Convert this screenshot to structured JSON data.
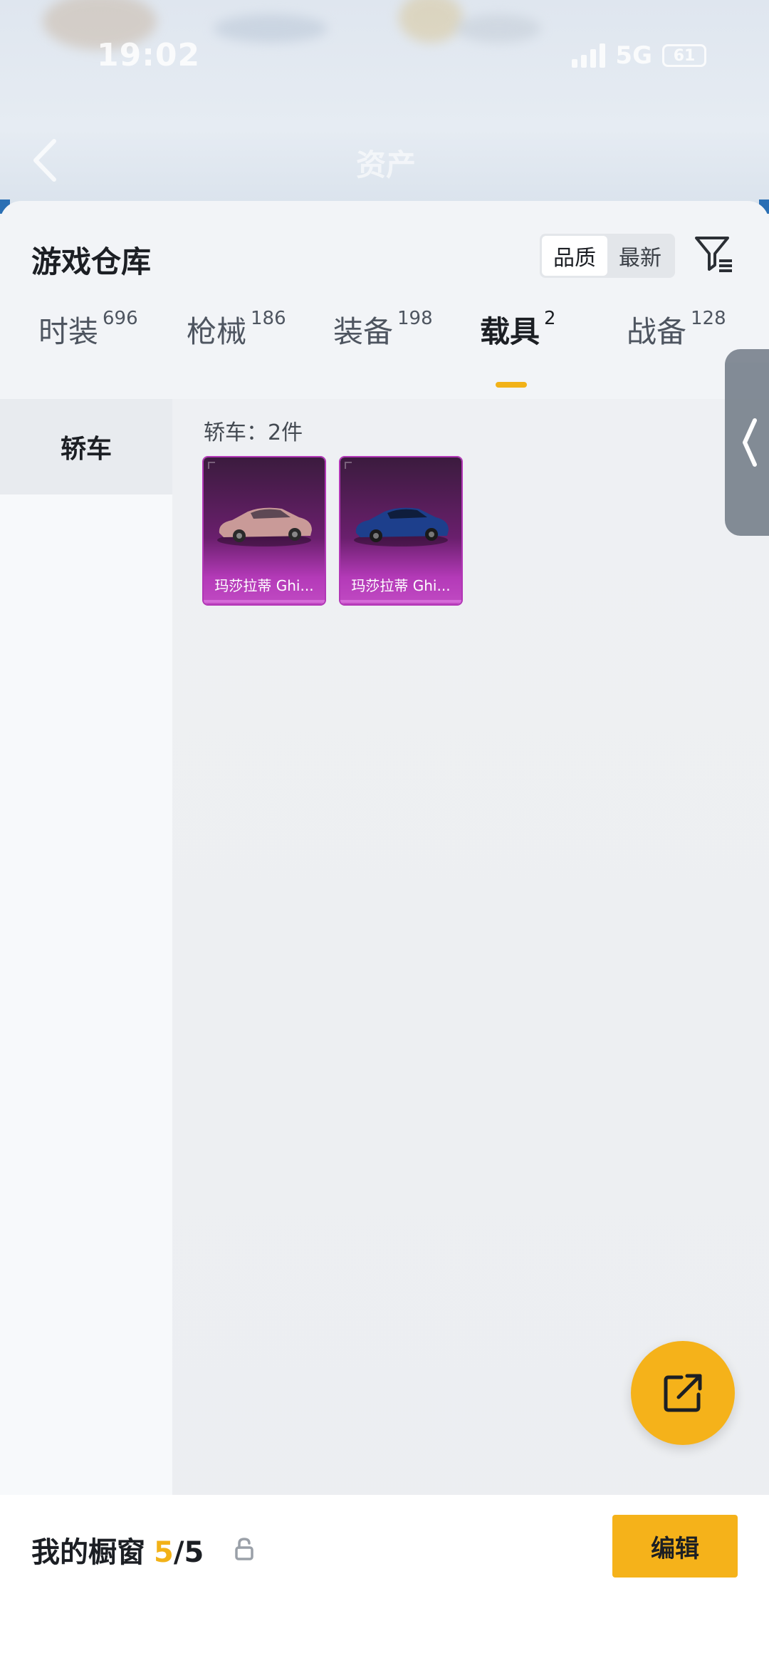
{
  "status_bar": {
    "time": "19:02",
    "network": "5G",
    "battery": "61"
  },
  "nav": {
    "title": "资产"
  },
  "header": {
    "title": "游戏仓库",
    "sort_options": [
      "品质",
      "最新"
    ],
    "sort_active": "品质"
  },
  "tabs": [
    {
      "label": "时装",
      "count": "696"
    },
    {
      "label": "枪械",
      "count": "186"
    },
    {
      "label": "装备",
      "count": "198"
    },
    {
      "label": "载具",
      "count": "2",
      "active": true
    },
    {
      "label": "战备",
      "count": "128"
    }
  ],
  "categories": [
    {
      "label": "轿车",
      "active": true
    }
  ],
  "content": {
    "count_label": "轿车：2件",
    "items": [
      {
        "name": "玛莎拉蒂 Ghi...",
        "car_color": "#c99a98"
      },
      {
        "name": "玛莎拉蒂 Ghi...",
        "car_color": "#1d3f8c"
      }
    ]
  },
  "bottom_bar": {
    "label": "我的橱窗",
    "count": "5",
    "total": "/5",
    "edit_label": "编辑"
  },
  "colors": {
    "accent": "#f5b21a",
    "item_rarity": "#b236b6"
  },
  "icons": [
    "back-icon",
    "filter-icon",
    "chevron-left-icon",
    "share-icon",
    "lock-icon"
  ]
}
